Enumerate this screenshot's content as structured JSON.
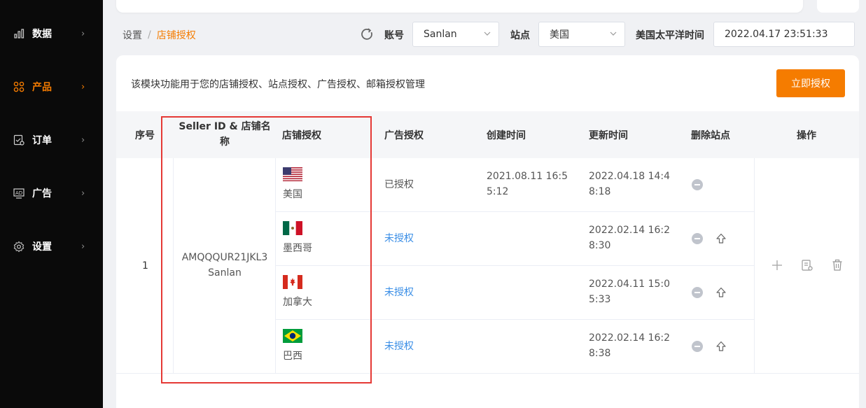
{
  "sidebar": {
    "items": [
      {
        "label": "数据",
        "icon": "bar-chart-icon",
        "active": false
      },
      {
        "label": "产品",
        "icon": "product-grid-icon",
        "active": true
      },
      {
        "label": "订单",
        "icon": "order-icon",
        "active": false
      },
      {
        "label": "广告",
        "icon": "ad-icon",
        "active": false
      },
      {
        "label": "设置",
        "icon": "gear-icon",
        "active": false
      }
    ],
    "chevron": "›"
  },
  "breadcrumb": {
    "root": "设置",
    "separator": "/",
    "current": "店铺授权"
  },
  "header": {
    "account_label": "账号",
    "account_value": "Sanlan",
    "site_label": "站点",
    "site_value": "美国",
    "tz_label": "美国太平洋时间",
    "tz_value": "2022.04.17 23:51:33"
  },
  "panel": {
    "description": "该模块功能用于您的店铺授权、站点授权、广告授权、邮箱授权管理",
    "auth_button": "立即授权"
  },
  "table": {
    "headers": {
      "index": "序号",
      "seller": "Seller ID & 店铺名称",
      "shop_auth": "店铺授权",
      "ad_auth": "广告授权",
      "created": "创建时间",
      "updated": "更新时间",
      "delete_site": "删除站点",
      "actions": "操作"
    },
    "row": {
      "index": "1",
      "seller_id": "AMQQQUR21JKL3",
      "shop_name": "Sanlan",
      "sites": [
        {
          "country": "美国",
          "flag": "us-flag-icon",
          "ad_status": "已授权",
          "ad_authorized": true,
          "created": "2021.08.11 16:55:12",
          "updated": "2022.04.18 14:48:18"
        },
        {
          "country": "墨西哥",
          "flag": "mexico-flag-icon",
          "ad_status": "未授权",
          "ad_authorized": false,
          "created": "",
          "updated": "2022.02.14 16:28:30"
        },
        {
          "country": "加拿大",
          "flag": "canada-flag-icon",
          "ad_status": "未授权",
          "ad_authorized": false,
          "created": "",
          "updated": "2022.04.11 15:05:33"
        },
        {
          "country": "巴西",
          "flag": "brazil-flag-icon",
          "ad_status": "未授权",
          "ad_authorized": false,
          "created": "",
          "updated": "2022.02.14 16:28:38"
        }
      ]
    }
  },
  "colors": {
    "accent": "#f57c00",
    "link": "#3a8ee6",
    "highlight": "#e53935"
  }
}
